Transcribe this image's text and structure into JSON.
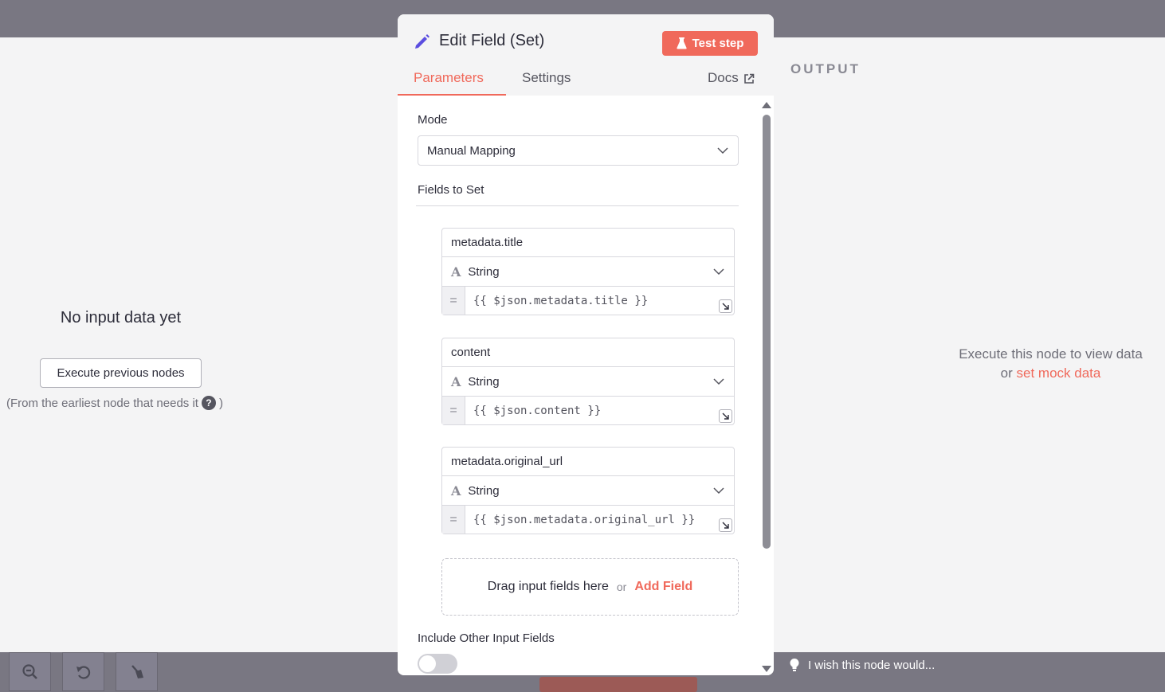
{
  "input_panel": {
    "empty_title": "No input data yet",
    "execute_button": "Execute previous nodes",
    "hint": "(From the earliest node that needs it",
    "hint_close": ")"
  },
  "node": {
    "title": "Edit Field (Set)",
    "test_button": "Test step",
    "tabs": {
      "parameters": "Parameters",
      "settings": "Settings",
      "docs": "Docs"
    },
    "mode_label": "Mode",
    "mode_value": "Manual Mapping",
    "fields_label": "Fields to Set",
    "fields": [
      {
        "name": "metadata.title",
        "type": "String",
        "value": "{{ $json.metadata.title }}"
      },
      {
        "name": "content",
        "type": "String",
        "value": "{{ $json.content }}"
      },
      {
        "name": "metadata.original_url",
        "type": "String",
        "value": "{{ $json.metadata.original_url }}"
      }
    ],
    "drop_text": "Drag input fields here",
    "drop_or": "or",
    "add_field": "Add Field",
    "include_label": "Include Other Input Fields",
    "include_enabled": false
  },
  "output_panel": {
    "title": "OUTPUT",
    "message_line1": "Execute this node to view data",
    "message_or": "or",
    "mock_link": "set mock data"
  },
  "footer": {
    "wish_text": "I wish this node would..."
  },
  "colors": {
    "accent": "#f0695b",
    "pencil": "#5b4ee0"
  }
}
